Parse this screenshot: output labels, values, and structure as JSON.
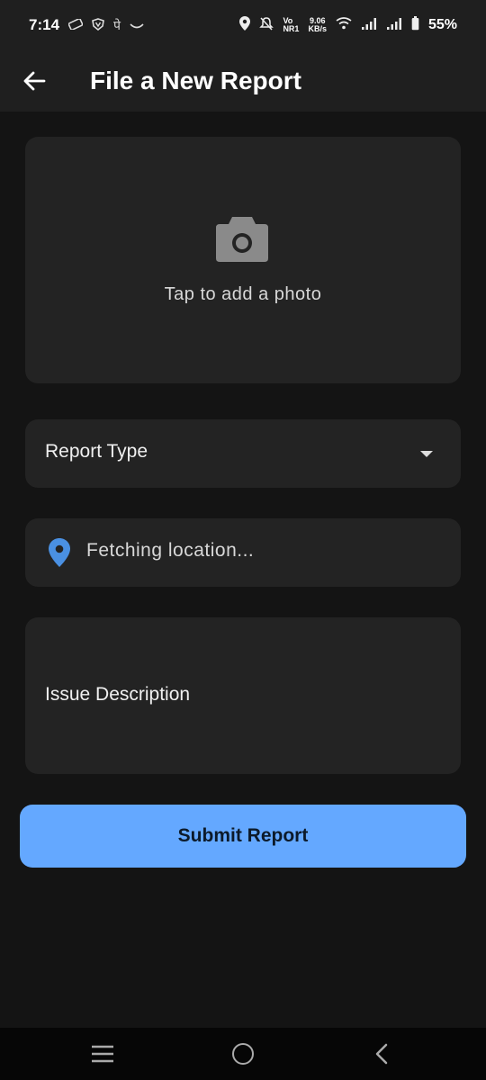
{
  "status_bar": {
    "time": "7:14",
    "left_icons": [
      "ticket-icon",
      "shield-v-icon",
      "pe-icon",
      "smile-icon"
    ],
    "left_glyphs": {
      "pe": "पे"
    },
    "network_speed": "9.06\nKB/s",
    "volte": "Vo\nNR1",
    "battery": "55%"
  },
  "app_bar": {
    "title": "File a New Report"
  },
  "photo": {
    "label": "Tap to add a photo"
  },
  "report_type": {
    "label": "Report Type"
  },
  "location": {
    "text": "Fetching location..."
  },
  "description": {
    "label": "Issue Description"
  },
  "submit": {
    "label": "Submit Report"
  },
  "colors": {
    "background": "#141414",
    "card": "#232323",
    "accent": "#64a8ff",
    "pin": "#4a90e2"
  }
}
